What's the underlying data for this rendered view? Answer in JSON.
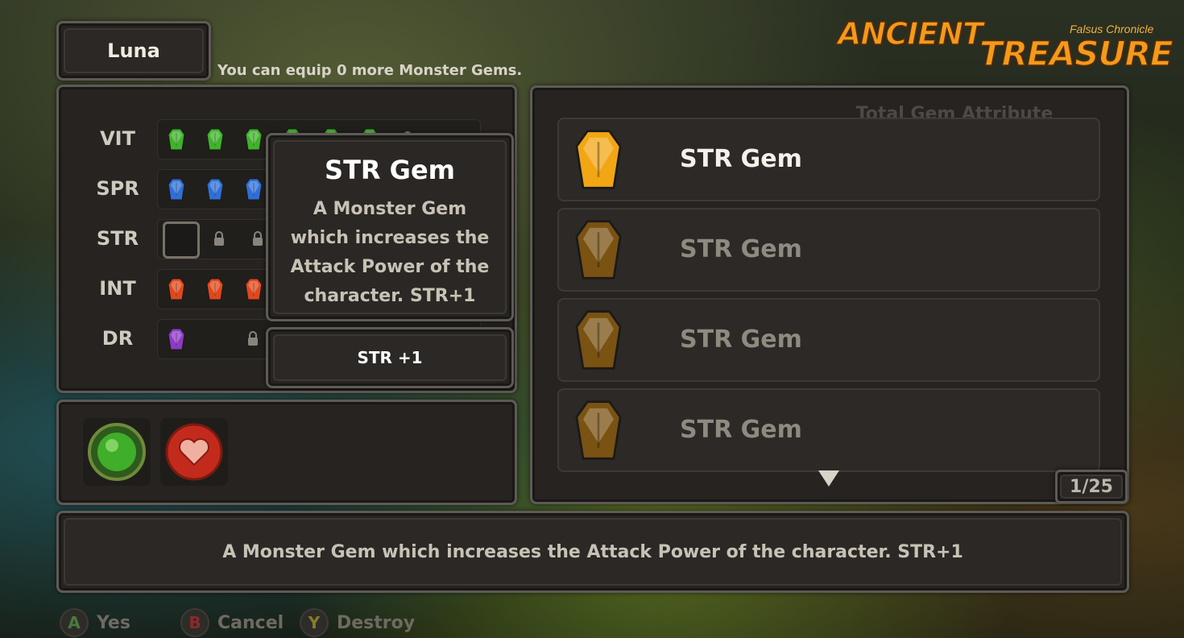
{
  "character": {
    "name": "Luna"
  },
  "equip_message": "You can equip 0 more Monster Gems.",
  "logo": {
    "part1": "ANCIENT",
    "part2": "TREASURE",
    "subtitle": "Falsus Chronicle"
  },
  "stats": [
    {
      "name": "VIT",
      "gem_color": "#3fb32a"
    },
    {
      "name": "SPR",
      "gem_color": "#2f6fd6"
    },
    {
      "name": "STR",
      "gem_color": "#e0a020"
    },
    {
      "name": "INT",
      "gem_color": "#e0481c"
    },
    {
      "name": "DR",
      "gem_color": "#8e3ac4"
    }
  ],
  "tooltip": {
    "title": "STR Gem",
    "description": "A Monster Gem which increases the Attack Power of the character.  STR+1",
    "stat": "STR +1"
  },
  "gem_list": {
    "hidden_header": "Total Gem Attribute",
    "items": [
      {
        "name": "STR Gem",
        "selected": true
      },
      {
        "name": "STR Gem",
        "selected": false
      },
      {
        "name": "STR Gem",
        "selected": false
      },
      {
        "name": "STR Gem",
        "selected": false
      }
    ],
    "page": "1/25"
  },
  "description": "A Monster Gem which increases the Attack Power of the character.  STR+1",
  "controls": [
    {
      "button": "A",
      "label": "Yes",
      "color": "#4a7a3a"
    },
    {
      "button": "B",
      "label": "Cancel",
      "color": "#8a2a2a"
    },
    {
      "button": "Y",
      "label": "Destroy",
      "color": "#8a7a2a"
    }
  ]
}
